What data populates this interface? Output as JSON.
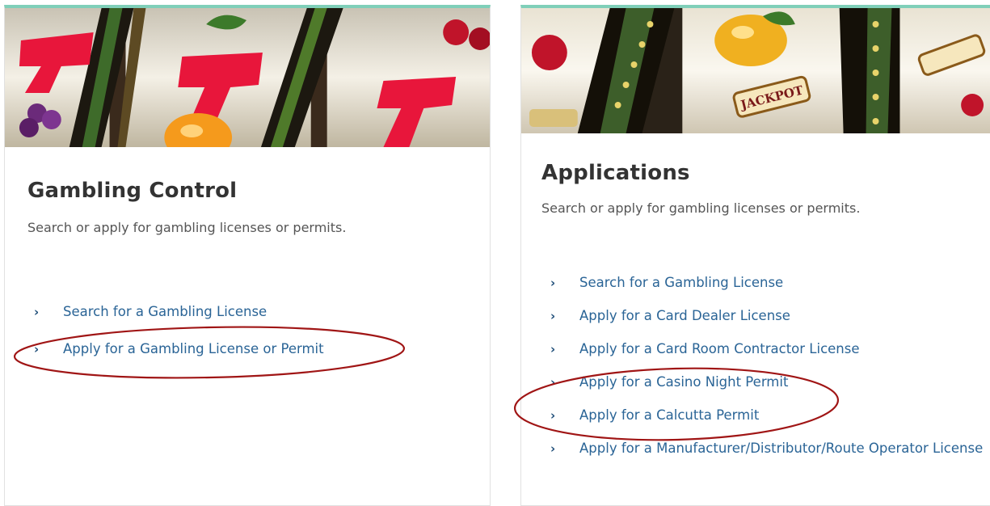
{
  "cards": [
    {
      "title": "Gambling Control",
      "description": "Search or apply for gambling licenses or permits.",
      "links": [
        "Search for a Gambling License",
        "Apply for a Gambling License or Permit"
      ]
    },
    {
      "title": "Applications",
      "description": "Search or apply for gambling licenses or permits.",
      "links": [
        "Search for a Gambling License",
        "Apply for a Card Dealer License",
        "Apply for a Card Room Contractor License",
        "Apply for a Casino Night Permit",
        "Apply for a Calcutta Permit",
        "Apply for a Manufacturer/Distributor/Route Operator License"
      ]
    }
  ],
  "hero2_labels": {
    "jackpot": "JACKPOT"
  },
  "icons": {
    "chevron": "›",
    "hero_images": [
      "slot-machine-777-image",
      "slot-machine-jackpot-image"
    ]
  },
  "colors": {
    "accent_top_border": "#7fcfb9",
    "link": "#2a6496",
    "annotation_circle": "#a01515"
  }
}
